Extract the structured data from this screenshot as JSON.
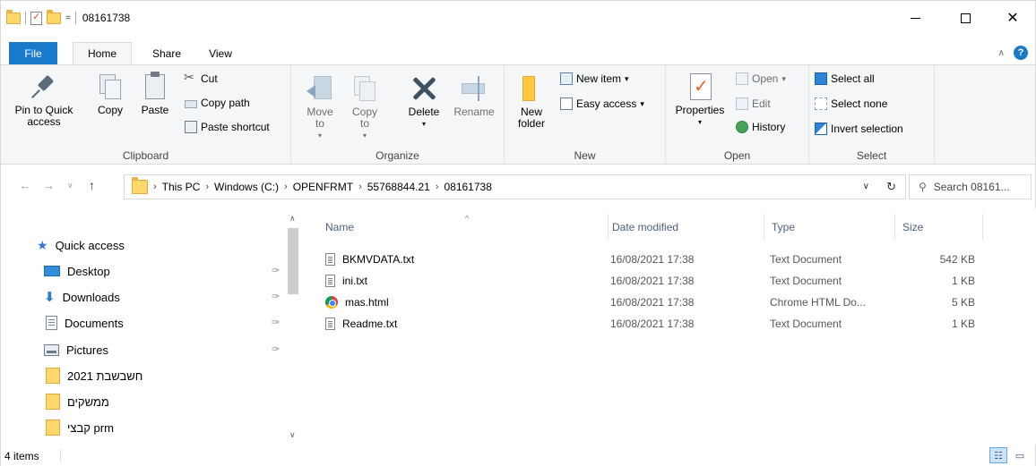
{
  "titlebar": {
    "title": "08161738",
    "qat_dropdown": "="
  },
  "ribbon_tabs": {
    "file": "File",
    "home": "Home",
    "share": "Share",
    "view": "View"
  },
  "clipboard": {
    "pin_label": "Pin to Quick access",
    "copy_label": "Copy",
    "paste_label": "Paste",
    "cut_label": "Cut",
    "copy_path_label": "Copy path",
    "paste_shortcut_label": "Paste shortcut",
    "group_label": "Clipboard"
  },
  "organize": {
    "move_to_label": "Move to",
    "copy_to_label": "Copy to",
    "delete_label": "Delete",
    "rename_label": "Rename",
    "group_label": "Organize"
  },
  "new_group": {
    "new_folder_label": "New folder",
    "new_item_label": "New item",
    "easy_access_label": "Easy access",
    "group_label": "New"
  },
  "open_group": {
    "properties_label": "Properties",
    "open_label": "Open",
    "edit_label": "Edit",
    "history_label": "History",
    "group_label": "Open"
  },
  "select_group": {
    "select_all_label": "Select all",
    "select_none_label": "Select none",
    "invert_selection_label": "Invert selection",
    "group_label": "Select"
  },
  "address": {
    "crumbs": [
      "This PC",
      "Windows (C:)",
      "OPENFRMT",
      "55768844.21",
      "08161738"
    ],
    "search_placeholder": "Search 08161..."
  },
  "nav_pane": {
    "quick_access": "Quick access",
    "items": [
      {
        "label": "Desktop",
        "pinned": true
      },
      {
        "label": "Downloads",
        "pinned": true
      },
      {
        "label": "Documents",
        "pinned": true
      },
      {
        "label": "Pictures",
        "pinned": true
      },
      {
        "label": "2021 חשבשבת",
        "pinned": false
      },
      {
        "label": "ממשקים",
        "pinned": false
      },
      {
        "label": "קבצי prm",
        "pinned": false
      }
    ]
  },
  "file_list": {
    "columns": {
      "name": "Name",
      "date": "Date modified",
      "type": "Type",
      "size": "Size"
    },
    "rows": [
      {
        "name": "BKMVDATA.txt",
        "date": "16/08/2021 17:38",
        "type": "Text Document",
        "size": "542 KB",
        "icon": "text-file-icon"
      },
      {
        "name": "ini.txt",
        "date": "16/08/2021 17:38",
        "type": "Text Document",
        "size": "1 KB",
        "icon": "text-file-icon"
      },
      {
        "name": "mas.html",
        "date": "16/08/2021 17:38",
        "type": "Chrome HTML Do...",
        "size": "5 KB",
        "icon": "chrome-icon"
      },
      {
        "name": "Readme.txt",
        "date": "16/08/2021 17:38",
        "type": "Text Document",
        "size": "1 KB",
        "icon": "text-file-icon"
      }
    ]
  },
  "status": {
    "item_count": "4 items"
  },
  "colors": {
    "file_tab": "#1979ca",
    "ribbon_bg": "#f5f6f7",
    "folder": "#ffd869",
    "header_text": "#4c607a"
  }
}
